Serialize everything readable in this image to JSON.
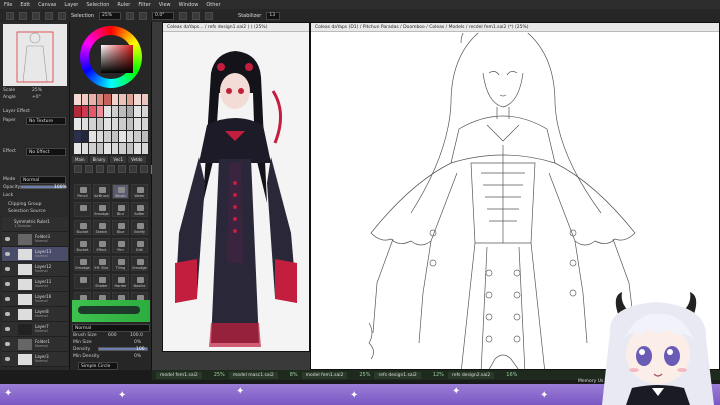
{
  "menubar": {
    "items": [
      "File",
      "Edit",
      "Canvas",
      "Layer",
      "Selection",
      "Ruler",
      "Filter",
      "View",
      "Window",
      "Other"
    ]
  },
  "toolbar": {
    "selection_label": "Selection",
    "zoom_value": "25%",
    "rotation_value": "0.0°",
    "stabilizer_label": "Stabilizer",
    "stabilizer_value": "13"
  },
  "left_panel": {
    "scale_label": "Scale",
    "scale_value": "25%",
    "angle_label": "Angle",
    "angle_value": "+0°",
    "layer_effect_label": "Layer Effect",
    "paper_label": "Paper",
    "paper_value": "No Texture",
    "effect_label": "Effect",
    "effect_value": "No Effect",
    "mode_label": "Mode",
    "mode_value": "Normal",
    "opacity_label": "Opacity",
    "opacity_value": "100%",
    "lock_label": "Lock",
    "clipping_group": "Clipping Group",
    "selection_source": "Selection Source",
    "layers": [
      {
        "name": "Symmetric Ruler1",
        "mode": "1 Division"
      },
      {
        "name": "Folder3",
        "mode": "Normal"
      },
      {
        "name": "Layer13",
        "mode": "Normal"
      },
      {
        "name": "Layer12",
        "mode": "Normal"
      },
      {
        "name": "Layer11",
        "mode": "Normal"
      },
      {
        "name": "Layer16",
        "mode": "Normal"
      },
      {
        "name": "Layer8",
        "mode": "Normal"
      },
      {
        "name": "Layer7",
        "mode": "Normal"
      },
      {
        "name": "Folder1",
        "mode": "Normal"
      },
      {
        "name": "Layer3",
        "mode": "Normal"
      }
    ]
  },
  "tool_panel": {
    "tabs": [
      "Main",
      "Binary",
      "Vec1",
      "Vetdo"
    ],
    "tools": [
      "Pencil",
      "AirBrush",
      "Brush",
      "Water",
      "",
      "Smudge",
      "Blur",
      "Softer",
      "Bucket",
      "Sketch",
      "Blue",
      "Eddify",
      "Bucket",
      "Effect",
      "Pen",
      "Edit",
      "Smudge",
      "Eff. Blur",
      "Tiling",
      "Smudge",
      "",
      "Shader",
      "Harder",
      "Nasihe",
      "Flush",
      "Eraser",
      "Bubble",
      "Shifter"
    ],
    "brush_size_label": "Brush Size",
    "brush_size_value": "600",
    "brush_size_max": "100.0",
    "min_size_label": "Min Size",
    "min_size_value": "0%",
    "density_label": "Density",
    "density_value": "100",
    "min_density_label": "Min Density",
    "min_density_value": "0%",
    "shape_label": "Simple Circle",
    "mode_value": "Normal"
  },
  "windows": {
    "win1_title": "Coleas daYaps... / refs design1.sai2 ( ) (25%)",
    "win2_title": "Coleas daYaps (D1) / Pitchun Paradas / Doomboo / Coleas / Models / recdel fem1.sai2 (*) (25%)"
  },
  "tabs": [
    {
      "label": "model fem1.sai2",
      "zoom": "25%"
    },
    {
      "label": "model masc1.sai2",
      "zoom": "8%"
    },
    {
      "label": "model fem1.sai2",
      "zoom": "25%"
    },
    {
      "label": "refs design1.sai2",
      "zoom": "12%"
    },
    {
      "label": "refs design2.sai2",
      "zoom": "16%"
    }
  ],
  "status": {
    "memory_label": "Memory Us"
  },
  "colors": {
    "panel_bg": "#262626",
    "selected_layer": "#4a4d6a",
    "purple_strip": "#8a6acb"
  }
}
